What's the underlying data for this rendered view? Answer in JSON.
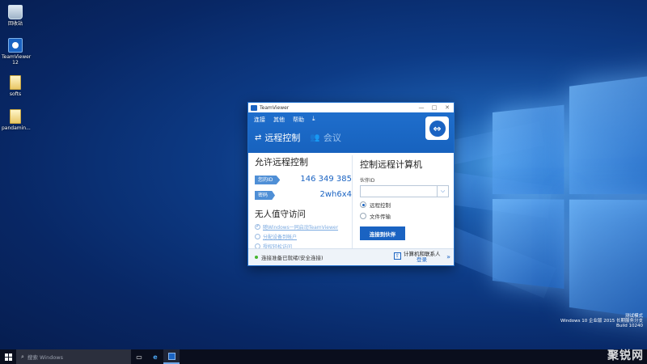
{
  "desktop": {
    "icons": [
      {
        "label": "回收站",
        "icon": "recycle-bin-icon"
      },
      {
        "label": "TeamViewer 12",
        "icon": "teamviewer-icon"
      },
      {
        "label": "softs",
        "icon": "folder-icon"
      },
      {
        "label": "pandamin...",
        "icon": "file-icon"
      }
    ],
    "watermark": {
      "line1": "测试模式",
      "line2": "Windows 10 企业版 2015 长期服务分支",
      "line3": "Build 10240"
    }
  },
  "teamviewer": {
    "title": "TeamViewer",
    "window_controls": {
      "minimize": "—",
      "maximize": "□",
      "close": "✕"
    },
    "menu": [
      "连接",
      "其他",
      "帮助"
    ],
    "tabs": [
      {
        "label": "远程控制",
        "icon": "swap-arrows-icon",
        "active": true
      },
      {
        "label": "会议",
        "icon": "people-icon",
        "active": false
      }
    ],
    "allow": {
      "heading": "允许远程控制",
      "id_label": "您的ID",
      "id_value": "146 349 385",
      "pw_label": "密码",
      "pw_value": "2wh6x4"
    },
    "unattended": {
      "heading": "无人值守访问",
      "items": [
        "随Windows一同启动TeamViewer",
        "分配设备到帐户",
        "授权轻松访问"
      ]
    },
    "control": {
      "heading": "控制远程计算机",
      "partner_label": "伙伴ID",
      "partner_value": "",
      "options": [
        {
          "label": "远程控制",
          "selected": true
        },
        {
          "label": "文件传输",
          "selected": false
        }
      ],
      "connect_button": "连接到伙伴"
    },
    "status": {
      "text": "连接准备已就绪(安全连接)",
      "color": "#45b52e",
      "contacts_label": "计算机和联系人",
      "login_label": "登录"
    }
  },
  "taskbar": {
    "search_placeholder": "搜索 Windows",
    "watermark_brand": "聚锐网"
  },
  "colors": {
    "accent": "#1a63c2",
    "desktop": "#0d3b86"
  }
}
